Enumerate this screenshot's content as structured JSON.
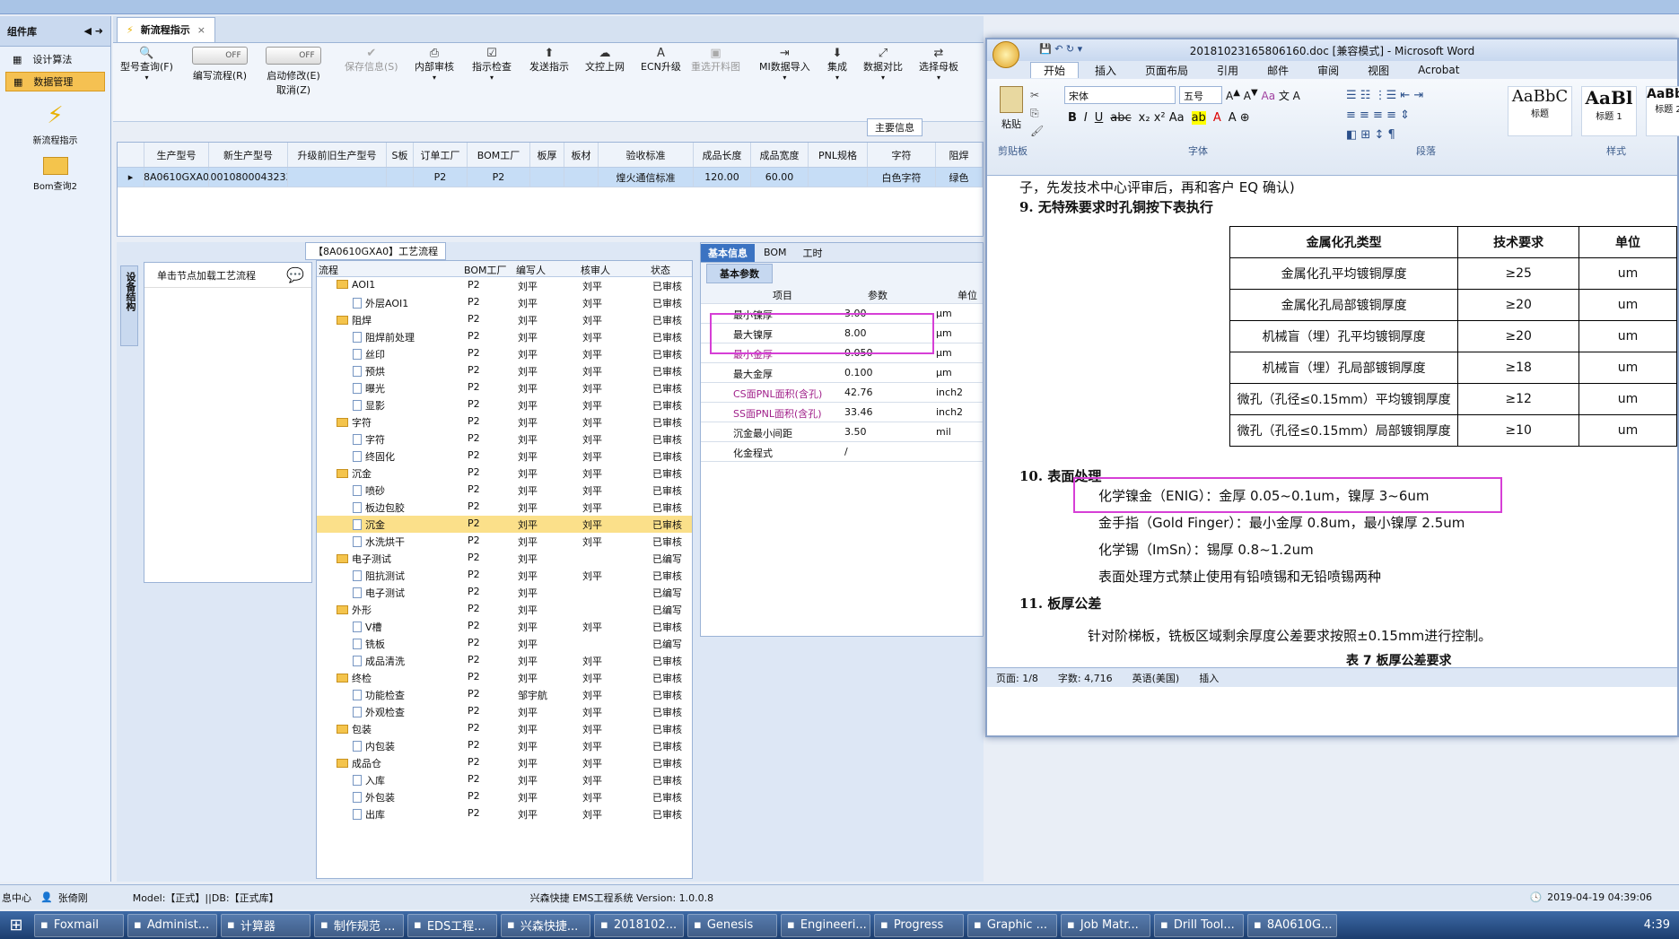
{
  "left_panel": {
    "header": "组件库",
    "items": [
      {
        "label": "设计算法",
        "active": false
      },
      {
        "label": "数据管理",
        "active": true
      }
    ],
    "big_icons": [
      {
        "label": "新流程指示",
        "icon": "lightning-icon"
      },
      {
        "label": "Bom查询2",
        "icon": "folder-icon"
      }
    ]
  },
  "tabs": {
    "doc_tab": "新流程指示",
    "close": "×"
  },
  "toolbar": {
    "buttons": [
      {
        "label": "型号查询(F)",
        "icon": "search-icon"
      },
      {
        "label": "编写流程(R)",
        "toggle": "OFF"
      },
      {
        "label": "启动修改(E)",
        "sub": "取消(Z)",
        "toggle": "OFF"
      },
      {
        "label": "保存信息(S)",
        "icon": "check-icon"
      },
      {
        "label": "内部审核",
        "icon": "print-icon"
      },
      {
        "label": "指示检查",
        "icon": "checklist-icon"
      },
      {
        "label": "发送指示",
        "icon": "upload-icon"
      },
      {
        "label": "文控上网",
        "icon": "cloud-icon"
      },
      {
        "label": "ECN升级",
        "icon": "letter-a-icon"
      },
      {
        "label": "重选开料图",
        "icon": "image-icon"
      },
      {
        "label": "MI数据导入",
        "icon": "import-icon"
      },
      {
        "label": "集成",
        "icon": "download-icon"
      },
      {
        "label": "数据对比",
        "icon": "compare-icon"
      },
      {
        "label": "选择母板",
        "icon": "shuffle-icon"
      }
    ],
    "section": "主要信息"
  },
  "main_grid": {
    "columns": [
      "生产型号",
      "新生产型号",
      "升级前旧生产型号",
      "S板",
      "订单工厂",
      "BOM工厂",
      "板厚",
      "板材",
      "验收标准",
      "成品长度",
      "成品宽度",
      "PNL规格",
      "字符",
      "阻焊"
    ],
    "row": [
      "8A0610GXA0",
      "10010800043233",
      "",
      "",
      "P2",
      "P2",
      "",
      "",
      "煌火通信标准",
      "120.00",
      "60.00",
      "",
      "白色字符",
      "绿色"
    ]
  },
  "flow_panel": {
    "title": "【8A0610GXA0】工艺流程",
    "side_tab": "设备结构",
    "hint": "单击节点加载工艺流程"
  },
  "tree": {
    "columns": [
      "流程",
      "BOM工厂",
      "编写人",
      "核审人",
      "状态"
    ],
    "rows": [
      {
        "name": "AOI1",
        "level": 1,
        "folder": true,
        "factory": "P2",
        "writer": "刘平",
        "reviewer": "刘平",
        "status": "已审核"
      },
      {
        "name": "外层AOI1",
        "level": 2,
        "folder": false,
        "factory": "P2",
        "writer": "刘平",
        "reviewer": "刘平",
        "status": "已审核"
      },
      {
        "name": "阻焊",
        "level": 1,
        "folder": true,
        "factory": "P2",
        "writer": "刘平",
        "reviewer": "刘平",
        "status": "已审核"
      },
      {
        "name": "阻焊前处理",
        "level": 2,
        "folder": false,
        "factory": "P2",
        "writer": "刘平",
        "reviewer": "刘平",
        "status": "已审核"
      },
      {
        "name": "丝印",
        "level": 2,
        "folder": false,
        "factory": "P2",
        "writer": "刘平",
        "reviewer": "刘平",
        "status": "已审核"
      },
      {
        "name": "预烘",
        "level": 2,
        "folder": false,
        "factory": "P2",
        "writer": "刘平",
        "reviewer": "刘平",
        "status": "已审核"
      },
      {
        "name": "曝光",
        "level": 2,
        "folder": false,
        "factory": "P2",
        "writer": "刘平",
        "reviewer": "刘平",
        "status": "已审核"
      },
      {
        "name": "显影",
        "level": 2,
        "folder": false,
        "factory": "P2",
        "writer": "刘平",
        "reviewer": "刘平",
        "status": "已审核"
      },
      {
        "name": "字符",
        "level": 1,
        "folder": true,
        "factory": "P2",
        "writer": "刘平",
        "reviewer": "刘平",
        "status": "已审核"
      },
      {
        "name": "字符",
        "level": 2,
        "folder": false,
        "factory": "P2",
        "writer": "刘平",
        "reviewer": "刘平",
        "status": "已审核"
      },
      {
        "name": "终固化",
        "level": 2,
        "folder": false,
        "factory": "P2",
        "writer": "刘平",
        "reviewer": "刘平",
        "status": "已审核"
      },
      {
        "name": "沉金",
        "level": 1,
        "folder": true,
        "factory": "P2",
        "writer": "刘平",
        "reviewer": "刘平",
        "status": "已审核"
      },
      {
        "name": "喷砂",
        "level": 2,
        "folder": false,
        "factory": "P2",
        "writer": "刘平",
        "reviewer": "刘平",
        "status": "已审核"
      },
      {
        "name": "板边包胶",
        "level": 2,
        "folder": false,
        "factory": "P2",
        "writer": "刘平",
        "reviewer": "刘平",
        "status": "已审核"
      },
      {
        "name": "沉金",
        "level": 2,
        "folder": false,
        "factory": "P2",
        "writer": "刘平",
        "reviewer": "刘平",
        "status": "已审核",
        "selected": true
      },
      {
        "name": "水洗烘干",
        "level": 2,
        "folder": false,
        "factory": "P2",
        "writer": "刘平",
        "reviewer": "刘平",
        "status": "已审核"
      },
      {
        "name": "电子测试",
        "level": 1,
        "folder": true,
        "factory": "P2",
        "writer": "刘平",
        "reviewer": "",
        "status": "已编写"
      },
      {
        "name": "阻抗测试",
        "level": 2,
        "folder": false,
        "factory": "P2",
        "writer": "刘平",
        "reviewer": "刘平",
        "status": "已审核"
      },
      {
        "name": "电子测试",
        "level": 2,
        "folder": false,
        "factory": "P2",
        "writer": "刘平",
        "reviewer": "",
        "status": "已编写"
      },
      {
        "name": "外形",
        "level": 1,
        "folder": true,
        "factory": "P2",
        "writer": "刘平",
        "reviewer": "",
        "status": "已编写"
      },
      {
        "name": "V槽",
        "level": 2,
        "folder": false,
        "factory": "P2",
        "writer": "刘平",
        "reviewer": "刘平",
        "status": "已审核"
      },
      {
        "name": "铣板",
        "level": 2,
        "folder": false,
        "factory": "P2",
        "writer": "刘平",
        "reviewer": "",
        "status": "已编写"
      },
      {
        "name": "成品清洗",
        "level": 2,
        "folder": false,
        "factory": "P2",
        "writer": "刘平",
        "reviewer": "刘平",
        "status": "已审核"
      },
      {
        "name": "终检",
        "level": 1,
        "folder": true,
        "factory": "P2",
        "writer": "刘平",
        "reviewer": "刘平",
        "status": "已审核"
      },
      {
        "name": "功能检查",
        "level": 2,
        "folder": false,
        "factory": "P2",
        "writer": "邹宇航",
        "reviewer": "刘平",
        "status": "已审核"
      },
      {
        "name": "外观检查",
        "level": 2,
        "folder": false,
        "factory": "P2",
        "writer": "刘平",
        "reviewer": "刘平",
        "status": "已审核"
      },
      {
        "name": "包装",
        "level": 1,
        "folder": true,
        "factory": "P2",
        "writer": "刘平",
        "reviewer": "刘平",
        "status": "已审核"
      },
      {
        "name": "内包装",
        "level": 2,
        "folder": false,
        "factory": "P2",
        "writer": "刘平",
        "reviewer": "刘平",
        "status": "已审核"
      },
      {
        "name": "成品仓",
        "level": 1,
        "folder": true,
        "factory": "P2",
        "writer": "刘平",
        "reviewer": "刘平",
        "status": "已审核"
      },
      {
        "name": "入库",
        "level": 2,
        "folder": false,
        "factory": "P2",
        "writer": "刘平",
        "reviewer": "刘平",
        "status": "已审核"
      },
      {
        "name": "外包装",
        "level": 2,
        "folder": false,
        "factory": "P2",
        "writer": "刘平",
        "reviewer": "刘平",
        "status": "已审核"
      },
      {
        "name": "出库",
        "level": 2,
        "folder": false,
        "factory": "P2",
        "writer": "刘平",
        "reviewer": "刘平",
        "status": "已审核"
      }
    ]
  },
  "params": {
    "tabs": [
      "基本信息",
      "BOM",
      "工时"
    ],
    "subtab": "基本参数",
    "columns": [
      "项目",
      "参数",
      "单位"
    ],
    "rows": [
      {
        "item": "最小镍厚",
        "value": "3.00",
        "unit": "μm",
        "color": "#111111"
      },
      {
        "item": "最大镍厚",
        "value": "8.00",
        "unit": "μm",
        "color": "#111111"
      },
      {
        "item": "最小金厚",
        "value": "0.050",
        "unit": "μm",
        "color": "#a0208a"
      },
      {
        "item": "最大金厚",
        "value": "0.100",
        "unit": "μm",
        "color": "#111111"
      },
      {
        "item": "CS面PNL面积(含孔)",
        "value": "42.76",
        "unit": "inch2",
        "color": "#a0208a"
      },
      {
        "item": "SS面PNL面积(含孔)",
        "value": "33.46",
        "unit": "inch2",
        "color": "#a0208a"
      },
      {
        "item": "沉金最小间距",
        "value": "3.50",
        "unit": "mil",
        "color": "#111111"
      },
      {
        "item": "化金程式",
        "value": "/",
        "unit": "",
        "color": "#111111"
      }
    ]
  },
  "word": {
    "title": "20181023165806160.doc [兼容模式] - Microsoft Word",
    "tabs": [
      "开始",
      "插入",
      "页面布局",
      "引用",
      "邮件",
      "审阅",
      "视图",
      "Acrobat"
    ],
    "ribbon": {
      "paste": "粘贴",
      "clipboard": "剪贴板",
      "font_name": "宋体",
      "font_size": "五号",
      "font_group": "字体",
      "para_group": "段落",
      "styles_group": "样式",
      "styles": [
        {
          "sample": "AaBbC",
          "name": "标题"
        },
        {
          "sample": "AaBl",
          "name": "标题 1"
        },
        {
          "sample": "AaBbC",
          "name": "标题 2"
        }
      ]
    },
    "doc": {
      "line0": "子，先发技术中心评审后，再和客户 EQ 确认)",
      "h9": "9. 无特殊要求时孔铜按下表执行",
      "table_head": [
        "金属化孔类型",
        "技术要求",
        "单位"
      ],
      "table_rows": [
        [
          "金属化孔平均镀铜厚度",
          "≥25",
          "um"
        ],
        [
          "金属化孔局部镀铜厚度",
          "≥20",
          "um"
        ],
        [
          "机械盲（埋）孔平均镀铜厚度",
          "≥20",
          "um"
        ],
        [
          "机械盲（埋）孔局部镀铜厚度",
          "≥18",
          "um"
        ],
        [
          "微孔（孔径≤0.15mm）平均镀铜厚度",
          "≥12",
          "um"
        ],
        [
          "微孔（孔径≤0.15mm）局部镀铜厚度",
          "≥10",
          "um"
        ]
      ],
      "h10": "10. 表面处理",
      "enig": "化学镍金（ENIG）：金厚 0.05~0.1um，镍厚 3~6um",
      "gold": "金手指（Gold Finger）：最小金厚 0.8um，最小镍厚 2.5um",
      "imsn": "化学锡（ImSn）：锡厚 0.8~1.2um",
      "forbid": "表面处理方式禁止使用有铅喷锡和无铅喷锡两种",
      "h11": "11. 板厚公差",
      "tol": "针对阶梯板，铣板区域剩余厚度公差要求按照±0.15mm进行控制。",
      "caption": "表 7  板厚公差要求"
    },
    "status": {
      "page": "页面: 1/8",
      "words": "字数: 4,716",
      "lang": "英语(美国)",
      "mode": "插入"
    }
  },
  "statusbar": {
    "left": "息中心",
    "user": "张倚刚",
    "model": "Model:【正式】||DB:【正式库】",
    "app": "兴森快捷 EMS工程系统  Version: 1.0.0.8",
    "datetime": "2019-04-19 04:39:06"
  },
  "taskbar": {
    "items": [
      "Foxmail",
      "Administ...",
      "计算器",
      "制作规范 ...",
      "EDS工程...",
      "兴森快捷...",
      "2018102...",
      "Genesis",
      "Engineeri...",
      "Progress",
      "Graphic ...",
      "Job Matr...",
      "Drill Tool...",
      "8A0610G..."
    ],
    "clock": "4:39"
  }
}
